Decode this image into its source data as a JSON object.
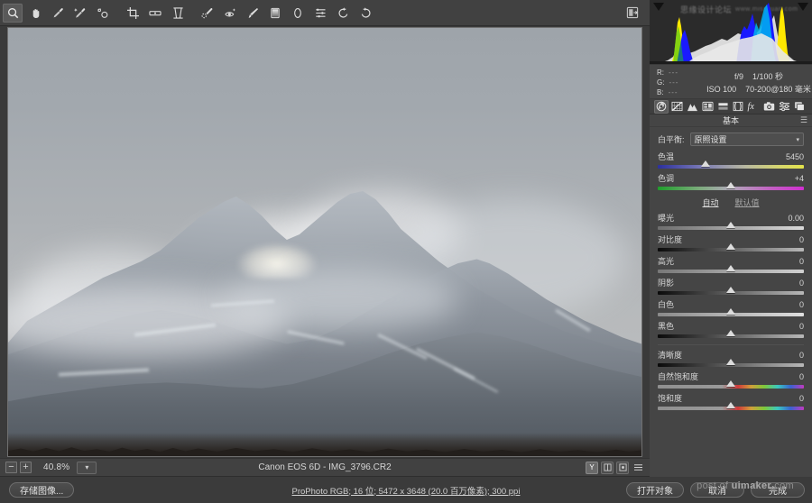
{
  "app": {
    "name": "Adobe Camera Raw"
  },
  "toolbar": {
    "tools": [
      {
        "name": "zoom-tool",
        "label": "缩放工具",
        "selected": true
      },
      {
        "name": "hand-tool",
        "label": "抓手工具",
        "selected": false
      },
      {
        "name": "white-balance-tool",
        "label": "白平衡工具",
        "selected": false
      },
      {
        "name": "color-sampler-tool",
        "label": "颜色取样器工具",
        "selected": false
      },
      {
        "name": "targeted-adjustment-tool",
        "label": "目标调整工具",
        "selected": false
      },
      {
        "name": "crop-tool",
        "label": "裁剪工具",
        "selected": false
      },
      {
        "name": "straighten-tool",
        "label": "拉直工具",
        "selected": false
      },
      {
        "name": "transform-tool",
        "label": "变换工具",
        "selected": false
      },
      {
        "name": "spot-removal-tool",
        "label": "污点去除",
        "selected": false
      },
      {
        "name": "red-eye-tool",
        "label": "红眼去除",
        "selected": false
      },
      {
        "name": "adjustment-brush-tool",
        "label": "调整画笔",
        "selected": false
      },
      {
        "name": "graduated-filter-tool",
        "label": "渐变滤镜",
        "selected": false
      },
      {
        "name": "radial-filter-tool",
        "label": "径向滤镜",
        "selected": false
      },
      {
        "name": "preferences-tool",
        "label": "打开首选项对话框",
        "selected": false
      },
      {
        "name": "rotate-left-tool",
        "label": "逆时针旋转",
        "selected": false
      },
      {
        "name": "rotate-right-tool",
        "label": "顺时针旋转",
        "selected": false
      }
    ],
    "fullscreen_label": "切换全屏模式"
  },
  "histogram": {
    "shadow_clip_label": "阴影剪切警告",
    "highlight_clip_label": "高光剪切警告",
    "watermark": "思缘设计论坛",
    "watermark_sub": "www.missyuan.com",
    "colors": {
      "yellow": "#ffe800",
      "blue": "#1a1aff",
      "cyan": "#00c8ff",
      "green": "#00c000",
      "gray": "#d8d8d8"
    }
  },
  "readout": {
    "r_label": "R:",
    "r_value": "---",
    "g_label": "G:",
    "g_value": "---",
    "b_label": "B:",
    "b_value": "---",
    "aperture": "f/9",
    "shutter": "1/100 秒",
    "iso": "ISO 100",
    "lens": "70-200@180 毫米"
  },
  "panel_tabs": [
    {
      "name": "tab-basic",
      "label": "基本",
      "icon": "aperture-icon",
      "selected": true
    },
    {
      "name": "tab-tone-curve",
      "label": "色调曲线",
      "icon": "tone-curve-icon",
      "selected": false
    },
    {
      "name": "tab-detail",
      "label": "细节",
      "icon": "detail-icon",
      "selected": false
    },
    {
      "name": "tab-hsl",
      "label": "HSL/灰度",
      "icon": "hsl-icon",
      "selected": false
    },
    {
      "name": "tab-split-toning",
      "label": "分离色调",
      "icon": "split-toning-icon",
      "selected": false
    },
    {
      "name": "tab-lens-corrections",
      "label": "镜头校正",
      "icon": "lens-icon",
      "selected": false
    },
    {
      "name": "tab-effects",
      "label": "效果",
      "icon": "fx-icon",
      "selected": false
    },
    {
      "name": "tab-camera-calibration",
      "label": "相机校准",
      "icon": "camera-icon",
      "selected": false
    },
    {
      "name": "tab-presets",
      "label": "预设",
      "icon": "presets-icon",
      "selected": false
    },
    {
      "name": "tab-snapshots",
      "label": "快照",
      "icon": "snapshots-icon",
      "selected": false
    }
  ],
  "basic_panel": {
    "title": "基本",
    "menu_label": "面板菜单",
    "white_balance": {
      "label": "白平衡:",
      "value": "原照设置"
    },
    "auto": "自动",
    "default": "默认值",
    "sliders": [
      {
        "name": "temperature",
        "label": "色温",
        "value": "5450",
        "pos": 33,
        "grad": "grad-temp"
      },
      {
        "name": "tint",
        "label": "色调",
        "value": "+4",
        "pos": 50,
        "grad": "grad-tint"
      },
      {
        "name": "exposure",
        "label": "曝光",
        "value": "0.00",
        "pos": 50,
        "grad": "grad-flat"
      },
      {
        "name": "contrast",
        "label": "对比度",
        "value": "0",
        "pos": 50,
        "grad": "grad-dark"
      },
      {
        "name": "highlights",
        "label": "高光",
        "value": "0",
        "pos": 50,
        "grad": "grad-flat"
      },
      {
        "name": "shadows",
        "label": "阴影",
        "value": "0",
        "pos": 50,
        "grad": "grad-dark"
      },
      {
        "name": "whites",
        "label": "白色",
        "value": "0",
        "pos": 50,
        "grad": "grad-flat"
      },
      {
        "name": "blacks",
        "label": "黑色",
        "value": "0",
        "pos": 50,
        "grad": "grad-dark"
      },
      {
        "name": "clarity",
        "label": "清晰度",
        "value": "0",
        "pos": 50,
        "grad": "grad-dark"
      },
      {
        "name": "vibrance",
        "label": "自然饱和度",
        "value": "0",
        "pos": 50,
        "grad": "grad-sat"
      },
      {
        "name": "saturation",
        "label": "饱和度",
        "value": "0",
        "pos": 50,
        "grad": "grad-sat"
      }
    ]
  },
  "statusbar": {
    "zoom_out": "−",
    "zoom_in": "+",
    "zoom_level": "40.8%",
    "zoom_menu": "▾",
    "filename": "Canon EOS 6D -  IMG_3796.CR2",
    "before_after_label": "Y",
    "buttons": [
      "before-after-toggle",
      "swap-before-after",
      "copy-settings",
      "preview-options"
    ]
  },
  "footer": {
    "save_image": "存储图像...",
    "workflow": "ProPhoto RGB; 16 位; 5472 x 3648 (20.0 百万像素); 300 ppi",
    "open_object": "打开对象",
    "cancel": "取消",
    "done": "完成",
    "watermark_prefix": "post of ",
    "watermark_brand": "uimaker",
    "watermark_suffix": ".com"
  },
  "image": {
    "alt": "雪山云雾风景照片",
    "subject": "Snow covered mountain peaks in mist"
  }
}
